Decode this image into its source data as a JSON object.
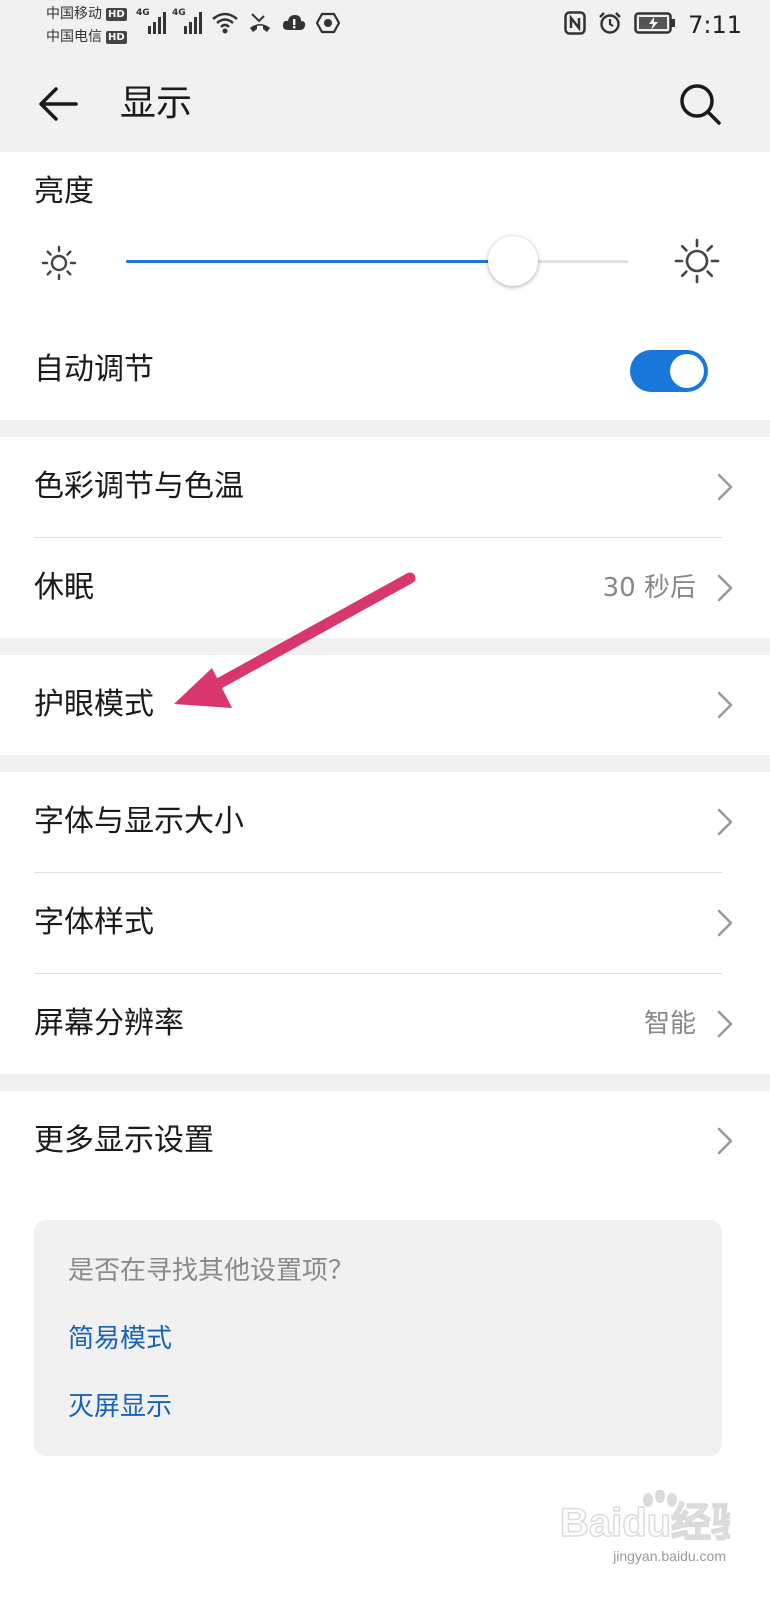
{
  "status_bar": {
    "carrier_1": "中国移动",
    "carrier_2": "中国电信",
    "hd_badge": "HD",
    "network_1": "4G",
    "network_2": "4G",
    "time": "7:11",
    "icons": [
      "signal-icon",
      "signal-icon",
      "wifi-icon",
      "missed-call-icon",
      "cloud-alert-icon",
      "app-notification-icon",
      "nfc-icon",
      "alarm-icon",
      "battery-charging-icon"
    ]
  },
  "app_bar": {
    "title": "显示",
    "back_icon": "arrow-left-icon",
    "search_icon": "search-icon"
  },
  "brightness": {
    "label": "亮度",
    "level": 0.77,
    "auto_label": "自动调节",
    "auto_on": true
  },
  "rows": {
    "color_temp": "色彩调节与色温",
    "sleep": "休眠",
    "sleep_value": "30 秒后",
    "eye_comfort": "护眼模式",
    "font_size": "字体与显示大小",
    "font_style": "字体样式",
    "resolution": "屏幕分辨率",
    "resolution_value": "智能",
    "more_settings": "更多显示设置"
  },
  "suggestions": {
    "question": "是否在寻找其他设置项？",
    "link_1": "简易模式",
    "link_2": "灭屏显示"
  },
  "colors": {
    "accent": "#1877d8",
    "annotation_arrow": "#d9356e",
    "link": "#1763b9"
  },
  "watermark": {
    "logo_text": "Baidu经验",
    "url": "jingyan.baidu.com"
  }
}
